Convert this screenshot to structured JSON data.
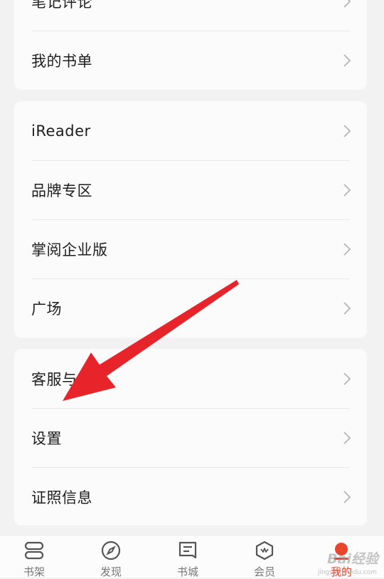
{
  "group1": {
    "items": [
      {
        "label": "笔记评论"
      },
      {
        "label": "我的书单"
      }
    ]
  },
  "group2": {
    "items": [
      {
        "label": "iReader"
      },
      {
        "label": "品牌专区"
      },
      {
        "label": "掌阅企业版"
      },
      {
        "label": "广场"
      }
    ]
  },
  "group3": {
    "items": [
      {
        "label": "客服与反馈"
      },
      {
        "label": "设置"
      },
      {
        "label": "证照信息"
      }
    ]
  },
  "tabbar": {
    "tabs": [
      {
        "label": "书架",
        "icon": "bookshelf-icon"
      },
      {
        "label": "发现",
        "icon": "compass-icon"
      },
      {
        "label": "书城",
        "icon": "bookstore-icon"
      },
      {
        "label": "会员",
        "icon": "vip-icon"
      },
      {
        "label": "我的",
        "icon": "profile-icon",
        "active": true
      }
    ]
  },
  "annotation": {
    "color": "#e8242b"
  },
  "watermark": {
    "text": "Bai经验",
    "sub": "jingyan.baidu.com"
  },
  "colors": {
    "accent": "#e8452c",
    "background": "#f2f2f2",
    "card": "#fbfbfb"
  }
}
